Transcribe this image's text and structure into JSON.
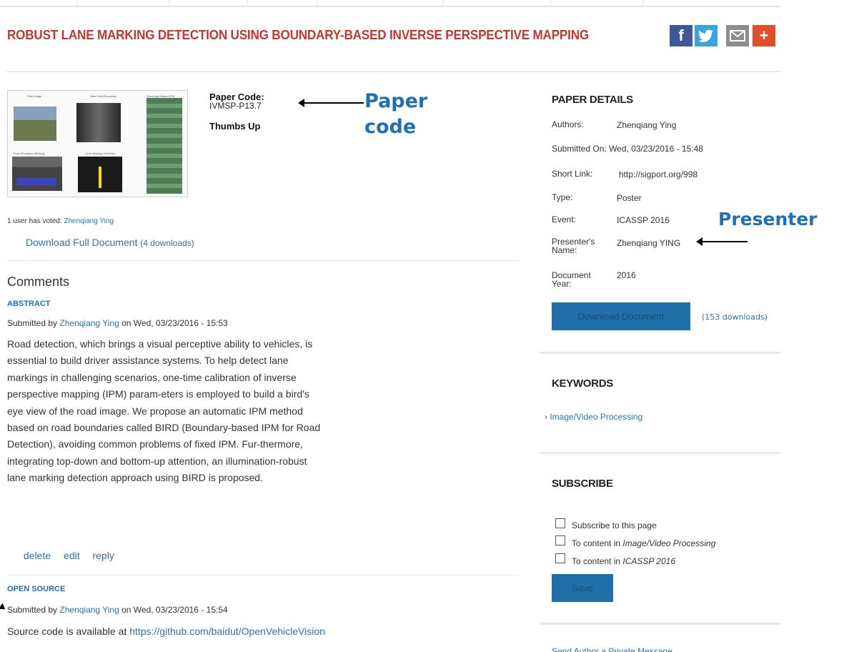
{
  "title": "ROBUST LANE MARKING DETECTION USING BOUNDARY-BASED INVERSE PERSPECTIVE MAPPING",
  "share": {
    "facebook_icon": "f",
    "twitter_icon": "twitter-bird",
    "email_icon": "envelope",
    "plus_icon": "+"
  },
  "thumbnail": {
    "labels": [
      "Raw Image",
      "Near-Field Boundary",
      "Boundary-Based IPM",
      "Road Boundary Marking",
      "Lane Marking Detection"
    ]
  },
  "paper": {
    "code_label": "Paper Code:",
    "code_value": "IVMSP-P13.7",
    "thumbs_up": "Thumbs Up"
  },
  "annotations": {
    "paper_code": "Paper code",
    "presenter": "Presenter"
  },
  "votes": {
    "prefix": "1 user has voted: ",
    "user": "Zhenqiang Ying"
  },
  "download_full": {
    "label": "Download Full Document",
    "count": "(4 downloads)"
  },
  "comments": {
    "heading": "Comments",
    "items": [
      {
        "title": "ABSTRACT",
        "submitted_prefix": "Submitted by ",
        "author": "Zhenqiang Ying",
        "submitted_suffix": " on Wed, 03/23/2016 - 15:53",
        "body": "Road detection, which brings a visual perceptive ability to vehicles, is essential to build driver assistance systems. To help detect lane markings in challenging scenarios, one-time calibration of inverse perspective mapping (IPM) param-eters is employed to build a bird's eye view of the road image. We propose an automatic IPM method based on road boundaries called BIRD (Boundary-based IPM for Road Detection), avoiding common problems of fixed IPM. Fur-thermore, integrating top-down and bottom-up attention, an illumination-robust lane marking detection approach using BIRD is proposed.",
        "actions": [
          "delete",
          "edit",
          "reply"
        ]
      },
      {
        "title": "OPEN SOURCE",
        "submitted_prefix": "Submitted by ",
        "author": "Zhenqiang Ying",
        "submitted_suffix": " on Wed, 03/23/2016 - 15:54",
        "body_prefix": "Source code is available at ",
        "body_link": "https://github.com/baidut/OpenVehicleVision"
      }
    ]
  },
  "details": {
    "heading": "PAPER DETAILS",
    "rows": [
      {
        "label": "Authors:",
        "value": "Zhenqiang Ying"
      },
      {
        "label": "Submitted On:",
        "value": "Wed, 03/23/2016 - 15:48"
      },
      {
        "label": "Short Link:",
        "value": "http://sigport.org/998"
      },
      {
        "label": "Type:",
        "value": "Poster"
      },
      {
        "label": "Event:",
        "value": "ICASSP 2016"
      },
      {
        "label": "Presenter's Name:",
        "value": "Zhenqiang YING"
      },
      {
        "label": "Document Year:",
        "value": "2016"
      }
    ],
    "download_button": "Download Document",
    "download_count": "(153 downloads)"
  },
  "keywords": {
    "heading": "KEYWORDS",
    "items": [
      "Image/Video Processing"
    ]
  },
  "subscribe": {
    "heading": "SUBSCRIBE",
    "options": [
      {
        "prefix": "Subscribe to this page",
        "italic": ""
      },
      {
        "prefix": "To content in ",
        "italic": "Image/Video Processing"
      },
      {
        "prefix": "To content in ",
        "italic": "ICASSP 2016"
      }
    ],
    "save": "Save"
  },
  "private_message": "Send Author a Private Message",
  "colors": {
    "title": "#c0392b",
    "link": "#2a73b0",
    "button": "#1f6fa8",
    "annotation": "#1f6fb5"
  }
}
